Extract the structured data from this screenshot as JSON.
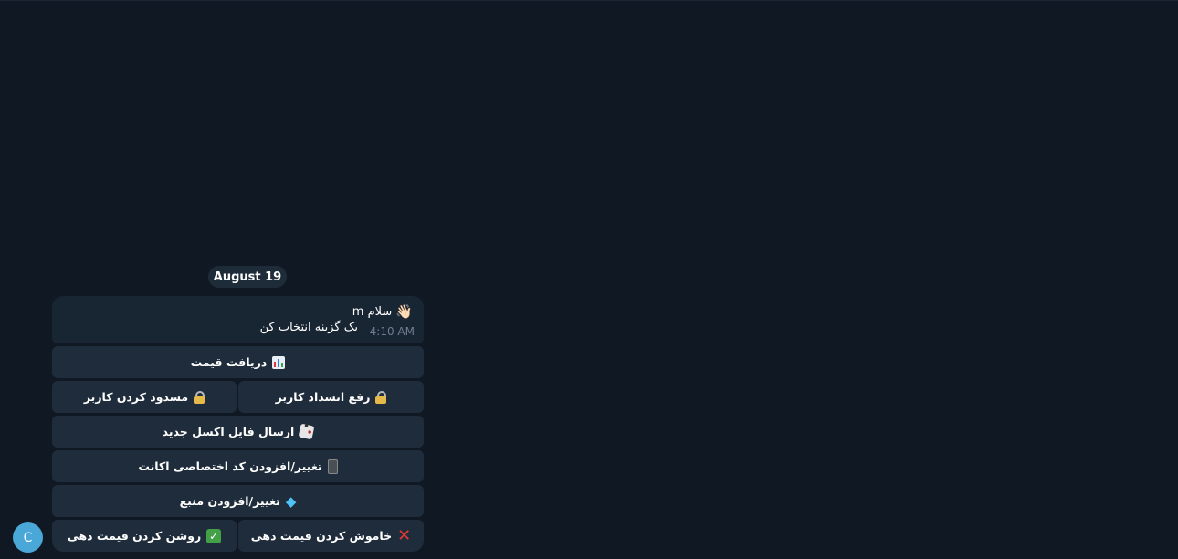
{
  "chat": {
    "date_label": "August 19",
    "message": {
      "icon": "waving-hand-icon",
      "line1": "سلام m",
      "line2": "یک گزینه انتخاب کن",
      "time": "4:10 AM"
    },
    "keyboard": {
      "get_price": {
        "label": "دریافت قیمت",
        "icon": "bar-chart-icon"
      },
      "unblock_user": {
        "label": "رفع انسداد کاربر",
        "icon": "lock-icon"
      },
      "block_user": {
        "label": "مسدود کردن کاربر",
        "icon": "lock-icon"
      },
      "send_excel": {
        "label": "ارسال فایل اکسل جدید",
        "icon": "dice-icon"
      },
      "change_account_code": {
        "label": "تغییر/افزودن کد اختصاصی اکانت",
        "icon": "phone-icon"
      },
      "change_source": {
        "label": "تغییر/افزودن منبع",
        "icon": "gem-icon"
      },
      "turn_off_pricing": {
        "label": "خاموش کردن قیمت دهی",
        "icon": "cross-mark-icon"
      },
      "turn_on_pricing": {
        "label": "روشن کردن قیمت دهی",
        "icon": "check-mark-icon"
      }
    },
    "avatar_letter": "C"
  },
  "colors": {
    "background": "#101823",
    "bubble": "#182533",
    "button": "#1f2c3b",
    "avatar": "#4aa8d9"
  }
}
